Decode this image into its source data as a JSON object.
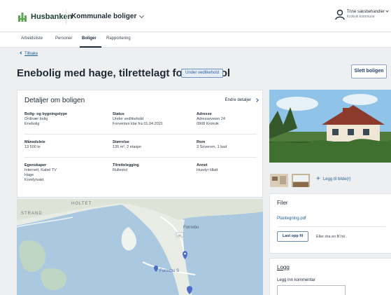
{
  "header": {
    "logo_text": "Husbanken",
    "app_selector": "Kommunale boliger",
    "user_name": "Trine saksbehandler",
    "user_org": "Krokvik kommune"
  },
  "tabs": [
    {
      "label": "Arbeidsliste",
      "active": false
    },
    {
      "label": "Personer",
      "active": false
    },
    {
      "label": "Boliger",
      "active": true
    },
    {
      "label": "Rapportering",
      "active": false
    }
  ],
  "back_label": "Tilbake",
  "page_title": "Enebolig med hage, tilrettelagt for rullestol",
  "status_badge": "Under vedlikehold",
  "delete_button": "Slett boligen",
  "details": {
    "title": "Detaljer om boligen",
    "edit_link": "Endre detaljer",
    "fields": [
      {
        "label": "Bolig- og bygningstype",
        "lines": [
          "Ordinær bolig",
          "Enebolig"
        ]
      },
      {
        "label": "Status",
        "lines": [
          "Under vedlikehold",
          "Forventes klar fra 01.04.2021"
        ]
      },
      {
        "label": "Adresse",
        "lines": [
          "Adresseveien 24",
          "0908 Krokvik"
        ]
      },
      {
        "label": "Månedsleie",
        "lines": [
          "13 500 kr"
        ]
      },
      {
        "label": "Størrelse",
        "lines": [
          "135 m², 2 etasjer"
        ]
      },
      {
        "label": "Rom",
        "lines": [
          "3 Soverom, 1 bad"
        ]
      },
      {
        "label": "Egenskaper",
        "lines": [
          "Internett, Kabel TV",
          "Hage",
          "Komfyrvakt"
        ]
      },
      {
        "label": "Tilrettelegging",
        "lines": [
          "Rullestol"
        ]
      },
      {
        "label": "Annet",
        "lines": [
          "Husdyr tillatt"
        ]
      }
    ]
  },
  "map": {
    "labels": {
      "strand": "STRAND",
      "holtet": "HOLTET",
      "fornebu": "Fornebu",
      "road_number": "160",
      "fornebu_s": "Fornebu S"
    }
  },
  "images": {
    "add_label": "Legg til bilde(r)"
  },
  "files": {
    "title": "Filer",
    "file_name": "Plantegning.pdf",
    "upload_button": "Last opp fil",
    "drag_text": "Eller dra en fil hit.."
  },
  "log": {
    "title": "Logg",
    "comment_label": "Legg inn kommentar"
  },
  "colors": {
    "accent": "#1f5f9c",
    "badge_bg": "#e5eef9",
    "logo_green": "#5aa653"
  }
}
